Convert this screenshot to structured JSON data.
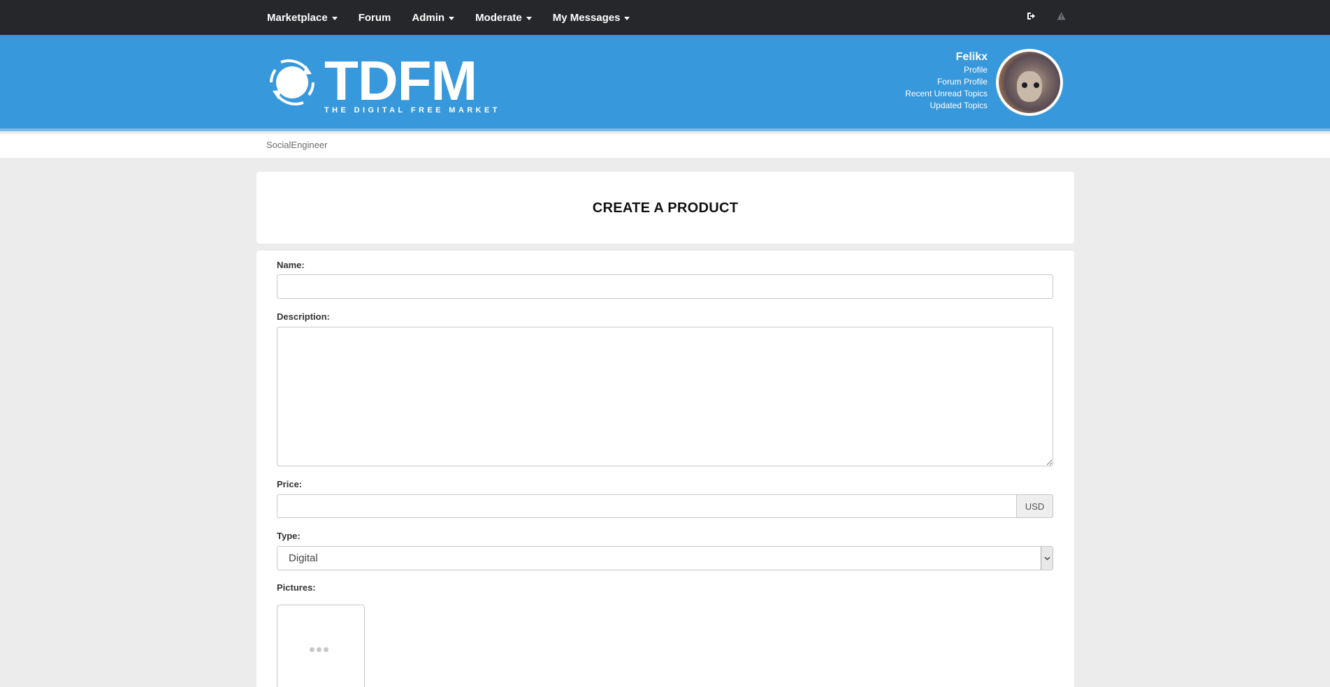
{
  "topnav": {
    "items": [
      {
        "label": "Marketplace",
        "has_caret": true
      },
      {
        "label": "Forum",
        "has_caret": false
      },
      {
        "label": "Admin",
        "has_caret": true
      },
      {
        "label": "Moderate",
        "has_caret": true
      },
      {
        "label": "My Messages",
        "has_caret": true
      }
    ],
    "right_icons": [
      "sign-out-icon",
      "warning-icon"
    ]
  },
  "header": {
    "logo": {
      "title": "TDFM",
      "tagline": "THE DIGITAL FREE MARKET"
    },
    "user": {
      "name": "Felikx",
      "links": [
        "Profile",
        "Forum Profile",
        "Recent Unread Topics",
        "Updated Topics"
      ]
    }
  },
  "breadcrumb": {
    "item": "SocialEngineer"
  },
  "page": {
    "title": "CREATE A PRODUCT"
  },
  "form": {
    "name_label": "Name:",
    "name_value": "",
    "description_label": "Description:",
    "description_value": "",
    "price_label": "Price:",
    "price_value": "",
    "price_currency": "USD",
    "type_label": "Type:",
    "type_value": "Digital",
    "pictures_label": "Pictures:"
  },
  "colors": {
    "topnav_bg": "#26272b",
    "header_bg": "#3798db",
    "page_bg": "#ececec"
  }
}
